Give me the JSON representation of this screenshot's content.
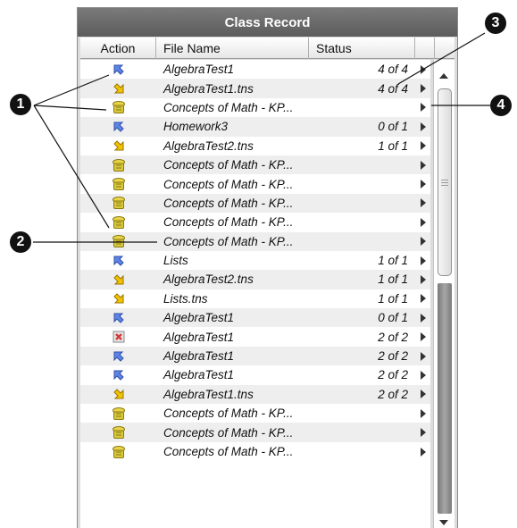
{
  "window": {
    "title": "Class Record"
  },
  "columns": {
    "action": "Action",
    "file": "File Name",
    "status": "Status"
  },
  "rows": [
    {
      "icon": "send-icon",
      "file": "AlgebraTest1",
      "status": "4 of 4"
    },
    {
      "icon": "collect-icon",
      "file": "AlgebraTest1.tns",
      "status": "4 of 4"
    },
    {
      "icon": "delete-files-icon",
      "file": "Concepts of Math - KP...",
      "status": ""
    },
    {
      "icon": "send-icon",
      "file": "Homework3",
      "status": "0 of 1"
    },
    {
      "icon": "collect-icon",
      "file": "AlgebraTest2.tns",
      "status": "1 of 1"
    },
    {
      "icon": "delete-files-icon",
      "file": "Concepts of Math - KP...",
      "status": ""
    },
    {
      "icon": "delete-files-icon",
      "file": "Concepts of Math - KP...",
      "status": ""
    },
    {
      "icon": "delete-files-icon",
      "file": "Concepts of Math - KP...",
      "status": ""
    },
    {
      "icon": "delete-files-icon",
      "file": "Concepts of Math - KP...",
      "status": ""
    },
    {
      "icon": "delete-files-icon",
      "file": "Concepts of Math - KP...",
      "status": ""
    },
    {
      "icon": "send-icon",
      "file": "Lists",
      "status": "1 of 1"
    },
    {
      "icon": "collect-icon",
      "file": "AlgebraTest2.tns",
      "status": "1 of 1"
    },
    {
      "icon": "collect-icon",
      "file": "Lists.tns",
      "status": "1 of 1"
    },
    {
      "icon": "send-icon",
      "file": "AlgebraTest1",
      "status": "0 of 1"
    },
    {
      "icon": "delete-from-class-icon",
      "file": "AlgebraTest1",
      "status": "2 of 2"
    },
    {
      "icon": "send-icon",
      "file": "AlgebraTest1",
      "status": "2 of 2"
    },
    {
      "icon": "send-icon",
      "file": "AlgebraTest1",
      "status": "2 of 2"
    },
    {
      "icon": "collect-icon",
      "file": "AlgebraTest1.tns",
      "status": "2 of 2"
    },
    {
      "icon": "delete-files-icon",
      "file": "Concepts of Math - KP...",
      "status": ""
    },
    {
      "icon": "delete-files-icon",
      "file": "Concepts of Math - KP...",
      "status": ""
    },
    {
      "icon": "delete-files-icon",
      "file": "Concepts of Math - KP...",
      "status": ""
    }
  ],
  "callouts": [
    "1",
    "2",
    "3",
    "4"
  ],
  "colors": {
    "title_bar": "#666666",
    "send_icon": "#4a6fd8",
    "collect_icon": "#e0b400",
    "delete_icon": "#c9b800",
    "remove_icon": "#d23b3b"
  }
}
